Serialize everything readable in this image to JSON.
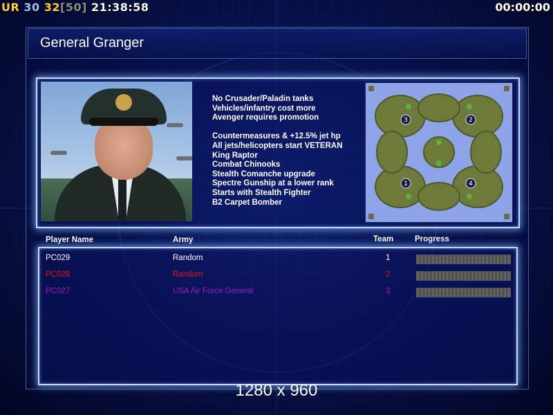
{
  "hud": {
    "left_ur": "UR",
    "left_a": "30",
    "left_b": "32",
    "left_c": "[50]",
    "left_time": "21:38:58",
    "right_timer": "00:00:00"
  },
  "title": "General Granger",
  "general_features": [
    "No Crusader/Paladin tanks",
    "Vehicles/infantry cost more",
    "Avenger requires promotion",
    "",
    "Countermeasures & +12.5% jet hp",
    "All jets/helicopters start VETERAN",
    "King Raptor",
    "Combat Chinooks",
    "Stealth Comanche upgrade",
    "Spectre Gunship at a lower rank",
    "Starts with Stealth Fighter",
    "B2 Carpet Bomber"
  ],
  "minimap": {
    "start_positions": [
      "1",
      "2",
      "3",
      "4"
    ]
  },
  "table": {
    "headers": {
      "player_name": "Player Name",
      "army": "Army",
      "team": "Team",
      "progress": "Progress"
    },
    "rows": [
      {
        "player": "PC029",
        "army": "Random",
        "team": "1",
        "color": "#ffffff",
        "progress": 0
      },
      {
        "player": "PC028",
        "army": "Random",
        "team": "2",
        "color": "#e01818",
        "progress": 0
      },
      {
        "player": "PC027",
        "army": "USA Air Force General",
        "team": "3",
        "color": "#a018c0",
        "progress": 0
      }
    ]
  },
  "resolution_label": "1280 x 960"
}
